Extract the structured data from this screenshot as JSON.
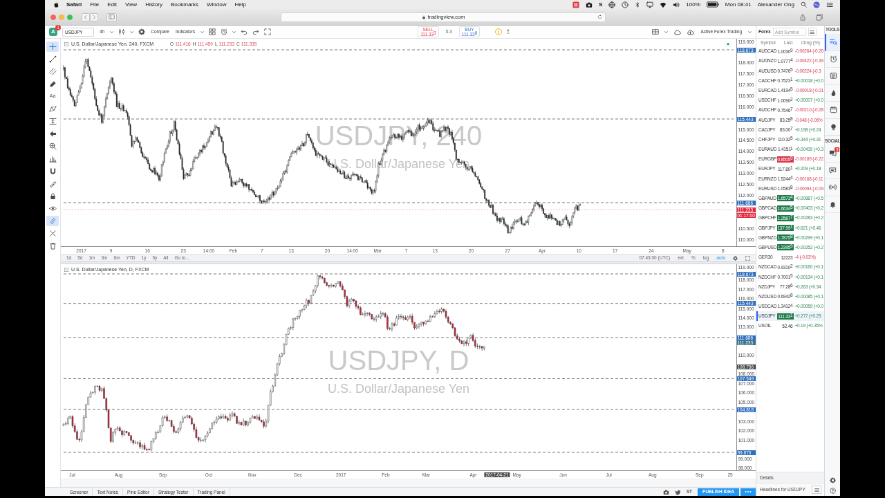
{
  "menu_bar": {
    "app": "Safari",
    "menus": [
      "File",
      "Edit",
      "View",
      "History",
      "Bookmarks",
      "Window",
      "Help"
    ],
    "status_glyph": "S",
    "battery": "100%",
    "clock": "Mon 08:41",
    "user": "Alexander Ong"
  },
  "browser": {
    "address": "tradingview.com"
  },
  "toolbar": {
    "avatar": "A",
    "badge": "1",
    "symbol": "USDJPY",
    "interval": "4h",
    "compare": "Compare",
    "indicators": "Indicators",
    "sell": {
      "label": "SELL",
      "price": "111.33$^{3}$"
    },
    "spread": "0.3",
    "buy": {
      "label": "BUY",
      "price": "111.33$^{6}$"
    },
    "layout": "Active Forex Trading"
  },
  "drawing_tools": [
    {
      "selected": true
    },
    {
      "selected": false
    },
    {
      "selected": false
    },
    {
      "selected": false
    },
    {
      "label": "Aa",
      "selected": false
    },
    {
      "selected": false
    },
    {
      "selected": false
    },
    {
      "selected": false
    },
    {
      "selected": false
    },
    {
      "selected": false
    },
    {
      "selected": false
    },
    {
      "selected": false
    },
    {
      "selected": false
    },
    {
      "selected": false
    },
    {
      "selected": true
    },
    {
      "selected": false
    },
    {
      "selected": false
    }
  ],
  "charts": [
    {
      "title": "U.S. Dollar/Japanese Yen, 240, FXCM",
      "negative": true,
      "ohlc": [
        {
          "label": "O",
          "value": "111.416"
        },
        {
          "label": "H",
          "value": "111.459"
        },
        {
          "label": "L",
          "value": "111.233"
        },
        {
          "label": "C",
          "value": "111.335"
        }
      ],
      "watermark": "USDJPY, 240",
      "watermark_subtitle": "U.S. Dollar/Japanese Yen",
      "price_labels": [
        {
          "text": "119.000",
          "kind": "tick"
        },
        {
          "text": "118.673",
          "kind": "line"
        },
        {
          "text": "118.000",
          "kind": "tick"
        },
        {
          "text": "117.500",
          "kind": "tick"
        },
        {
          "text": "117.000",
          "kind": "tick"
        },
        {
          "text": "116.500",
          "kind": "tick"
        },
        {
          "text": "116.000",
          "kind": "tick"
        },
        {
          "text": "115.443",
          "kind": "line"
        },
        {
          "text": "115.000",
          "kind": "tick"
        },
        {
          "text": "114.500",
          "kind": "tick"
        },
        {
          "text": "114.000",
          "kind": "tick"
        },
        {
          "text": "113.500",
          "kind": "tick"
        },
        {
          "text": "113.000",
          "kind": "tick"
        },
        {
          "text": "112.500",
          "kind": "tick"
        },
        {
          "text": "112.000",
          "kind": "tick"
        },
        {
          "text": "111.686",
          "kind": "line"
        },
        {
          "text": "111.233",
          "kind": "last"
        },
        {
          "text": "01:17:00",
          "kind": "countdown"
        },
        {
          "text": "110.500",
          "kind": "tick"
        },
        {
          "text": "110.000",
          "kind": "tick"
        }
      ],
      "time_labels": [
        {
          "text": "2017",
          "kind": "tick"
        },
        {
          "text": "9",
          "kind": "tick"
        },
        {
          "text": "16",
          "kind": "tick"
        },
        {
          "text": "23",
          "kind": "tick"
        },
        {
          "text": "14:00",
          "kind": "tick"
        },
        {
          "text": "Feb",
          "kind": "tick"
        },
        {
          "text": "7",
          "kind": "tick"
        },
        {
          "text": "13",
          "kind": "tick"
        },
        {
          "text": "20",
          "kind": "tick"
        },
        {
          "text": "14:00",
          "kind": "tick"
        },
        {
          "text": "Mar",
          "kind": "tick"
        },
        {
          "text": "7",
          "kind": "tick"
        },
        {
          "text": "13",
          "kind": "tick"
        },
        {
          "text": "20",
          "kind": "tick"
        },
        {
          "text": "27",
          "kind": "tick"
        },
        {
          "text": "Apr",
          "kind": "tick"
        },
        {
          "text": "10",
          "kind": "tick"
        },
        {
          "text": "17",
          "kind": "tick"
        },
        {
          "text": "24",
          "kind": "tick"
        },
        {
          "text": "May",
          "kind": "tick"
        },
        {
          "text": "8",
          "kind": "tick"
        }
      ],
      "ranges": [
        "1d",
        "5d",
        "1m",
        "3m",
        "6m",
        "YTD",
        "1y",
        "5y",
        "All",
        "Go to..."
      ],
      "clock": "07:43:00 (UTC)",
      "scale_options": [
        {
          "label": "ext",
          "selected": false
        },
        {
          "label": "%",
          "selected": false
        },
        {
          "label": "log",
          "selected": false
        },
        {
          "label": "auto",
          "selected": true
        }
      ]
    },
    {
      "title": "U.S. Dollar/Japanese Yen, D, FXCM",
      "watermark": "USDJPY, D",
      "watermark_subtitle": "U.S. Dollar/Japanese Yen",
      "price_labels": [
        {
          "text": "119.000",
          "kind": "tick"
        },
        {
          "text": "118.673",
          "kind": "line"
        },
        {
          "text": "118.000",
          "kind": "tick"
        },
        {
          "text": "117.000",
          "kind": "tick"
        },
        {
          "text": "116.000",
          "kind": "tick"
        },
        {
          "text": "115.443",
          "kind": "line"
        },
        {
          "text": "115.000",
          "kind": "tick"
        },
        {
          "text": "114.000",
          "kind": "tick"
        },
        {
          "text": "113.000",
          "kind": "tick"
        },
        {
          "text": "111.686",
          "kind": "line"
        },
        {
          "text": "111.233",
          "kind": "mark"
        },
        {
          "text": "110.000",
          "kind": "tick"
        },
        {
          "text": "108.756",
          "kind": "cursor"
        },
        {
          "text": "108.000",
          "kind": "tick"
        },
        {
          "text": "107.549",
          "kind": "line"
        },
        {
          "text": "107.000",
          "kind": "tick"
        },
        {
          "text": "106.000",
          "kind": "tick"
        },
        {
          "text": "105.000",
          "kind": "tick"
        },
        {
          "text": "104.818",
          "kind": "line"
        },
        {
          "text": "103.000",
          "kind": "tick"
        },
        {
          "text": "102.000",
          "kind": "tick"
        },
        {
          "text": "101.000",
          "kind": "tick"
        },
        {
          "text": "99.870",
          "kind": "line"
        },
        {
          "text": "99.000",
          "kind": "tick"
        },
        {
          "text": "98.000",
          "kind": "tick"
        }
      ],
      "time_labels": [
        {
          "text": "Jul",
          "kind": "tick"
        },
        {
          "text": "Aug",
          "kind": "tick"
        },
        {
          "text": "Sep",
          "kind": "tick"
        },
        {
          "text": "Oct",
          "kind": "tick"
        },
        {
          "text": "Nov",
          "kind": "tick"
        },
        {
          "text": "Dec",
          "kind": "tick"
        },
        {
          "text": "2017",
          "kind": "tick"
        },
        {
          "text": "Feb",
          "kind": "tick"
        },
        {
          "text": "Mar",
          "kind": "tick"
        },
        {
          "text": "Apr",
          "kind": "tick"
        },
        {
          "text": "2017-04-21",
          "kind": "cursor"
        },
        {
          "text": "May",
          "kind": "tick"
        },
        {
          "text": "Jun",
          "kind": "tick"
        },
        {
          "text": "Jul",
          "kind": "tick"
        },
        {
          "text": "Aug",
          "kind": "tick"
        },
        {
          "text": "Sep",
          "kind": "tick"
        },
        {
          "text": "25",
          "kind": "tick"
        }
      ]
    }
  ],
  "watchlist": {
    "title": "Forex",
    "search_placeholder": "Add Symbol",
    "columns": [
      "Symbol",
      "Last",
      "Chng (%)"
    ],
    "rows": [
      {
        "symbol": "AUDCAD",
        "last": "1.0030$^{9}$",
        "change": "-0.00264 (-0.26",
        "negative": true,
        "flashing": false,
        "selected": false
      },
      {
        "symbol": "AUDNZD",
        "last": "1.0777$^{4}$",
        "change": "-0.00422 (-0.39",
        "negative": true,
        "flashing": false,
        "selected": false
      },
      {
        "symbol": "AUDUSD",
        "last": "0.7476$^{5}$",
        "change": "-0.00224 (-0.3",
        "negative": true,
        "flashing": false,
        "selected": false
      },
      {
        "symbol": "CADCHF",
        "last": "0.7523$^{1}$",
        "change": "+0.00018 (+0.0",
        "negative": false,
        "flashing": false,
        "selected": false
      },
      {
        "symbol": "EURCAD",
        "last": "1.4194$^{5}$",
        "change": "-0.00018 (-0.01",
        "negative": true,
        "flashing": false,
        "selected": false
      },
      {
        "symbol": "USDCHF",
        "last": "1.0090$^{2}$",
        "change": "+0.00007 (+0.0",
        "negative": false,
        "flashing": false,
        "selected": false
      },
      {
        "symbol": "AUDCHF",
        "last": "0.7546$^{7}$",
        "change": "-0.00210 (-0.28",
        "negative": true,
        "flashing": false,
        "selected": false
      },
      {
        "symbol": "AUDJPY",
        "last": "83.25$^{8}$",
        "change": "-0.048 (-0.06%",
        "negative": true,
        "flashing": false,
        "selected": false
      },
      {
        "symbol": "CADJPY",
        "last": "83.00$^{7}$",
        "change": "+0.198 (+0.24",
        "negative": false,
        "flashing": false,
        "selected": false
      },
      {
        "symbol": "CHFJPY",
        "last": "110.32$^{5}$",
        "change": "+0.344 (+0.31",
        "negative": false,
        "flashing": false,
        "selected": false
      },
      {
        "symbol": "EURAUD",
        "last": "1.4151$^{1}$",
        "change": "+0.00439 (+0.3",
        "negative": false,
        "flashing": false,
        "selected": false
      },
      {
        "symbol": "EURGBP",
        "last": "0.8505$^{9}$",
        "change": "-0.00189 (-0.22",
        "negative": true,
        "flashing": true,
        "selected": false
      },
      {
        "symbol": "EURJPY",
        "last": "117.80$^{1}$",
        "change": "+0.209 (+0.18",
        "negative": false,
        "flashing": false,
        "selected": false
      },
      {
        "symbol": "EURNZD",
        "last": "1.5244$^{4}$",
        "change": "-0.00168 (-0.11",
        "negative": true,
        "flashing": false,
        "selected": false
      },
      {
        "symbol": "EURUSD",
        "last": "1.0583$^{8}$",
        "change": "-0.00094 (-0.09",
        "negative": true,
        "flashing": false,
        "selected": false
      },
      {
        "symbol": "GBPAUD",
        "last": "1.6573$^{4}$",
        "change": "+0.00887 (+0.5",
        "negative": false,
        "flashing": true,
        "selected": false
      },
      {
        "symbol": "GBPCAD",
        "last": "1.6634$^{5}$",
        "change": "+0.00403 (+0.2",
        "negative": false,
        "flashing": true,
        "selected": false
      },
      {
        "symbol": "GBPCHF",
        "last": "1.2587$^{7}$",
        "change": "+0.00283 (+0.2",
        "negative": false,
        "flashing": true,
        "selected": false
      },
      {
        "symbol": "GBPJPY",
        "last": "137.99$^{1}$",
        "change": "+0.621 (+0.46",
        "negative": false,
        "flashing": true,
        "selected": false
      },
      {
        "symbol": "GBPNZD",
        "last": "1.7875$^{8}$",
        "change": "+0.00299 (+0.1",
        "negative": false,
        "flashing": true,
        "selected": false
      },
      {
        "symbol": "GBPUSD",
        "last": "1.2395$^{9}$",
        "change": "+0.00252 (+0.2",
        "negative": false,
        "flashing": true,
        "selected": false
      },
      {
        "symbol": "GER30",
        "last": "12223",
        "change": "-4 (-0.03%)",
        "negative": true,
        "flashing": false,
        "selected": false
      },
      {
        "symbol": "NZDCAD",
        "last": "0.9310$^{2}$",
        "change": "+0.00160 (+0.1",
        "negative": false,
        "flashing": false,
        "selected": false
      },
      {
        "symbol": "NZDCHF",
        "last": "0.7001$^{5}$",
        "change": "+0.00134 (+0.1",
        "negative": false,
        "flashing": false,
        "selected": false
      },
      {
        "symbol": "NZDJPY",
        "last": "77.28$^{6}$",
        "change": "+0.263 (+0.34",
        "negative": false,
        "flashing": false,
        "selected": false
      },
      {
        "symbol": "NZDUSD",
        "last": "0.6942$^{8}$",
        "change": "+0.00085 (+0.1",
        "negative": false,
        "flashing": false,
        "selected": false
      },
      {
        "symbol": "USDCAD",
        "last": "1.3412$^{4}$",
        "change": "+0.00059 (+0.0",
        "negative": false,
        "flashing": false,
        "selected": false
      },
      {
        "symbol": "USDJPY",
        "last": "111.33$^{1}$",
        "change": "+0.277 (+0.25",
        "negative": false,
        "flashing": true,
        "selected": true
      },
      {
        "symbol": "USOIL",
        "last": "52.46",
        "change": "+0.19 (+0.35%",
        "negative": false,
        "flashing": false,
        "selected": false
      }
    ],
    "details": "Details",
    "headlines": "Headlines for USDJPY"
  },
  "tools_panel": {
    "title": "TOOLS",
    "items": [
      {
        "selected": true
      },
      {
        "selected": false
      },
      {
        "selected": false
      },
      {
        "selected": false
      },
      {
        "selected": false
      },
      {
        "selected": false
      }
    ],
    "social_title": "SOCIAL",
    "chat_badge": "3"
  },
  "bottom_bar": {
    "tabs": [
      "Screener",
      "Text Notes",
      "Pine Editor",
      "Strategy Tester",
      "Trading Panel"
    ],
    "share": "ST",
    "publish": "PUBLISH IDEA"
  }
}
